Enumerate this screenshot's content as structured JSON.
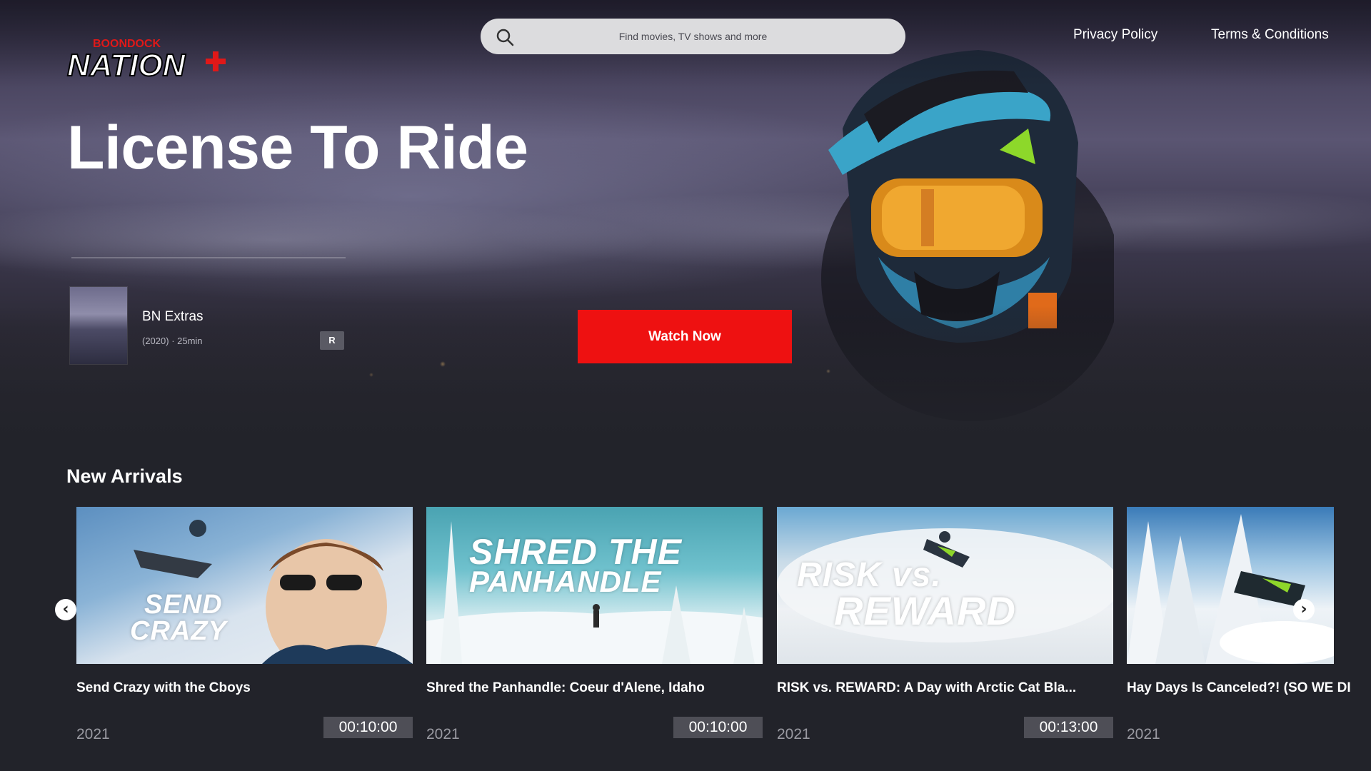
{
  "brand": {
    "logo_small": "BOONDOCK",
    "logo_main": "NATION",
    "accent": "#ee1111"
  },
  "search": {
    "placeholder": "Find movies, TV shows and more"
  },
  "nav": {
    "privacy": "Privacy Policy",
    "terms": "Terms & Conditions"
  },
  "hero": {
    "title": "License To Ride",
    "collection": "BN Extras",
    "meta": "(2020) · 25min",
    "rating": "R",
    "watch_label": "Watch Now"
  },
  "new_arrivals": {
    "title": "New Arrivals",
    "items": [
      {
        "title": "Send Crazy with the Cboys",
        "year": "2021",
        "duration": "00:10:00",
        "thumb_text": [
          "SEND",
          "CRAZY"
        ]
      },
      {
        "title": "Shred the Panhandle: Coeur d'Alene, Idaho",
        "year": "2021",
        "duration": "00:10:00",
        "thumb_text": [
          "SHRED THE",
          "PANHANDLE"
        ]
      },
      {
        "title": "RISK vs. REWARD: A Day with Arctic Cat Bla...",
        "year": "2021",
        "duration": "00:13:00",
        "thumb_text": [
          "RISK vs.",
          "REWARD"
        ]
      },
      {
        "title": "Hay Days Is Canceled?! (SO WE DI",
        "year": "2021",
        "duration": "",
        "thumb_text": []
      }
    ],
    "prev_icon": "chevron-left-icon",
    "next_icon": "chevron-right-icon"
  }
}
